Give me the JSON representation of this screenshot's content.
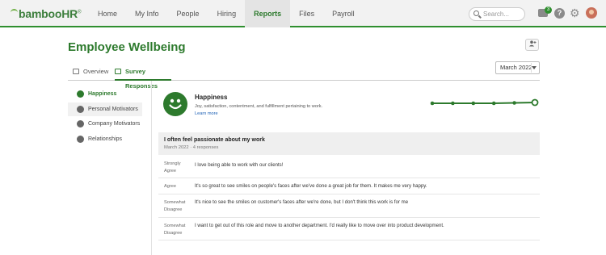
{
  "brand": {
    "logo_text": "bambooHR",
    "logo_mark": "®",
    "accent": "#2d7a2d"
  },
  "nav": {
    "items": [
      {
        "label": "Home"
      },
      {
        "label": "My Info"
      },
      {
        "label": "People"
      },
      {
        "label": "Hiring"
      },
      {
        "label": "Reports",
        "active": true
      },
      {
        "label": "Files"
      },
      {
        "label": "Payroll"
      }
    ],
    "search_placeholder": "Search...",
    "inbox_count": "3",
    "help_glyph": "?",
    "gear_glyph": "⚙"
  },
  "page": {
    "title": "Employee Wellbeing",
    "tabs": [
      {
        "label": "Overview",
        "icon": "report-icon"
      },
      {
        "label": "Survey Responses",
        "icon": "chart-icon",
        "active": true
      }
    ],
    "month_selected": "March 2022"
  },
  "sidebar": {
    "items": [
      {
        "label": "Happiness",
        "icon": "smiley-icon",
        "active": true
      },
      {
        "label": "Personal Motivators",
        "icon": "person-heart-icon"
      },
      {
        "label": "Company Motivators",
        "icon": "building-icon"
      },
      {
        "label": "Relationships",
        "icon": "people-icon"
      }
    ]
  },
  "metric": {
    "title": "Happiness",
    "description": "Joy, satisfaction, contentment, and fulfillment pertaining to work.",
    "learn_more": "Learn more",
    "trend_points": [
      0,
      0,
      0,
      0,
      0.05,
      0.1
    ]
  },
  "question": {
    "text": "I often feel passionate about my work",
    "meta": "March 2022 · 4 responses"
  },
  "responses": [
    {
      "rating": "Strongly Agree",
      "text": "I love being able to work with our clients!"
    },
    {
      "rating": "Agree",
      "text": "It's so great to see smiles on people's faces after we've done a great job for them. It makes me very happy."
    },
    {
      "rating": "Somewhat Disagree",
      "text": "It's nice to see the smiles on customer's faces after we're done, but I don't think this work is for me"
    },
    {
      "rating": "Somewhat Disagree",
      "text": "I want to get out of this role and move to another department. I'd really like to move over into product development."
    }
  ]
}
